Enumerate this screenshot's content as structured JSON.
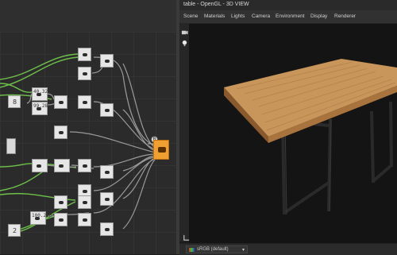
{
  "graph": {
    "out_badge": "B",
    "nodes": [
      {
        "name": "node-a1",
        "label": ""
      },
      {
        "name": "node-a2",
        "label": ""
      },
      {
        "name": "node-b1",
        "label": ""
      },
      {
        "name": "node-b2",
        "label": "40.32"
      },
      {
        "name": "node-b3",
        "label": "99.28"
      },
      {
        "name": "node-b4",
        "label": "8"
      },
      {
        "name": "node-c1",
        "label": ""
      },
      {
        "name": "node-c2",
        "label": ""
      },
      {
        "name": "node-c3",
        "label": ""
      },
      {
        "name": "node-d1",
        "label": ""
      },
      {
        "name": "node-d2",
        "label": ""
      },
      {
        "name": "node-d3",
        "label": ""
      },
      {
        "name": "node-e1",
        "label": ""
      },
      {
        "name": "node-e2",
        "label": ""
      },
      {
        "name": "node-e3",
        "label": ""
      },
      {
        "name": "node-f1",
        "label": "2"
      },
      {
        "name": "node-f2",
        "label": "100.200"
      }
    ]
  },
  "view": {
    "title": "table - OpenGL - 3D VIEW",
    "menu": [
      "Scene",
      "Materials",
      "Lights",
      "Camera",
      "Environment",
      "Display",
      "Renderer"
    ],
    "colorspace": "sRGB (default)"
  },
  "colors": {
    "graph_bg": "#2b2b2b",
    "output_node": "#f0a030",
    "wire_green": "#6ec04a",
    "wire_gray": "#9a9a9a"
  },
  "icons": [
    "camera-icon",
    "light-bulb-icon",
    "axis-icon",
    "colorspace-icon",
    "chevron-down-icon"
  ]
}
